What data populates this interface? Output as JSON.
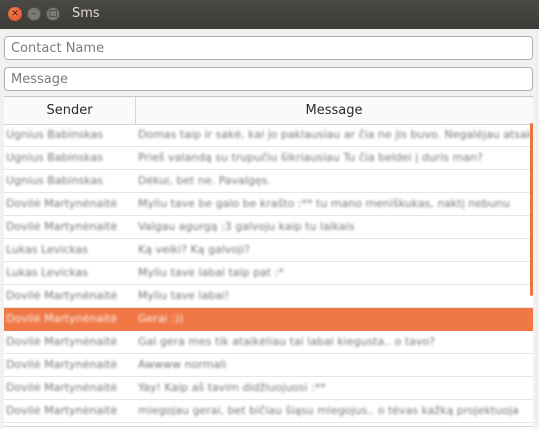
{
  "window": {
    "title": "Sms"
  },
  "inputs": {
    "contact_placeholder": "Contact Name",
    "message_placeholder": "Message"
  },
  "table": {
    "columns": [
      "Sender",
      "Message"
    ],
    "selected_index": 8,
    "rows": [
      {
        "sender": "Ugnius Babinskas",
        "message": "Domas taip ir sakė, kai jo paklausiau ar čia ne jis buvo. Negalėjau atsakyti"
      },
      {
        "sender": "Ugnius Babinskas",
        "message": "Prieš valandą su trupučiu šikriausiau Tu čia beldei į duris man?"
      },
      {
        "sender": "Ugnius Babinskas",
        "message": "Dėkui, bet ne. Pavalgęs."
      },
      {
        "sender": "Dovilė Martynėnaitė",
        "message": "Myliu tave be galo be krašto :** tu mano meniškukas, naktį nebunu"
      },
      {
        "sender": "Dovilė Martynėnaitė",
        "message": "Valgau agurgą :3 galvoju kaip tu laikais"
      },
      {
        "sender": "Lukas Levickas",
        "message": "Ką veiki? Ką galvoji?"
      },
      {
        "sender": "Lukas Levickas",
        "message": "Myliu tave labai taip pat :*"
      },
      {
        "sender": "Dovilė Martynėnaitė",
        "message": "Myliu tave labai!"
      },
      {
        "sender": "Dovilė Martynėnaitė",
        "message": "Gerai :))"
      },
      {
        "sender": "Dovilė Martynėnaitė",
        "message": "Gal gera mes tik ataikėliau tai labai kiegusta.. o tavo?"
      },
      {
        "sender": "Dovilė Martynėnaitė",
        "message": "Awwww normali"
      },
      {
        "sender": "Dovilė Martynėnaitė",
        "message": "Yay! Kaip aš tavim didžiuojuosi :**"
      },
      {
        "sender": "Dovilė Martynėnaitė",
        "message": "miegojau gerai, bet bičiau šiąsu miegojus.. o tėvas kažką projektuoja"
      }
    ]
  },
  "colors": {
    "accent": "#f07746",
    "titlebar": "#3c3b37"
  }
}
